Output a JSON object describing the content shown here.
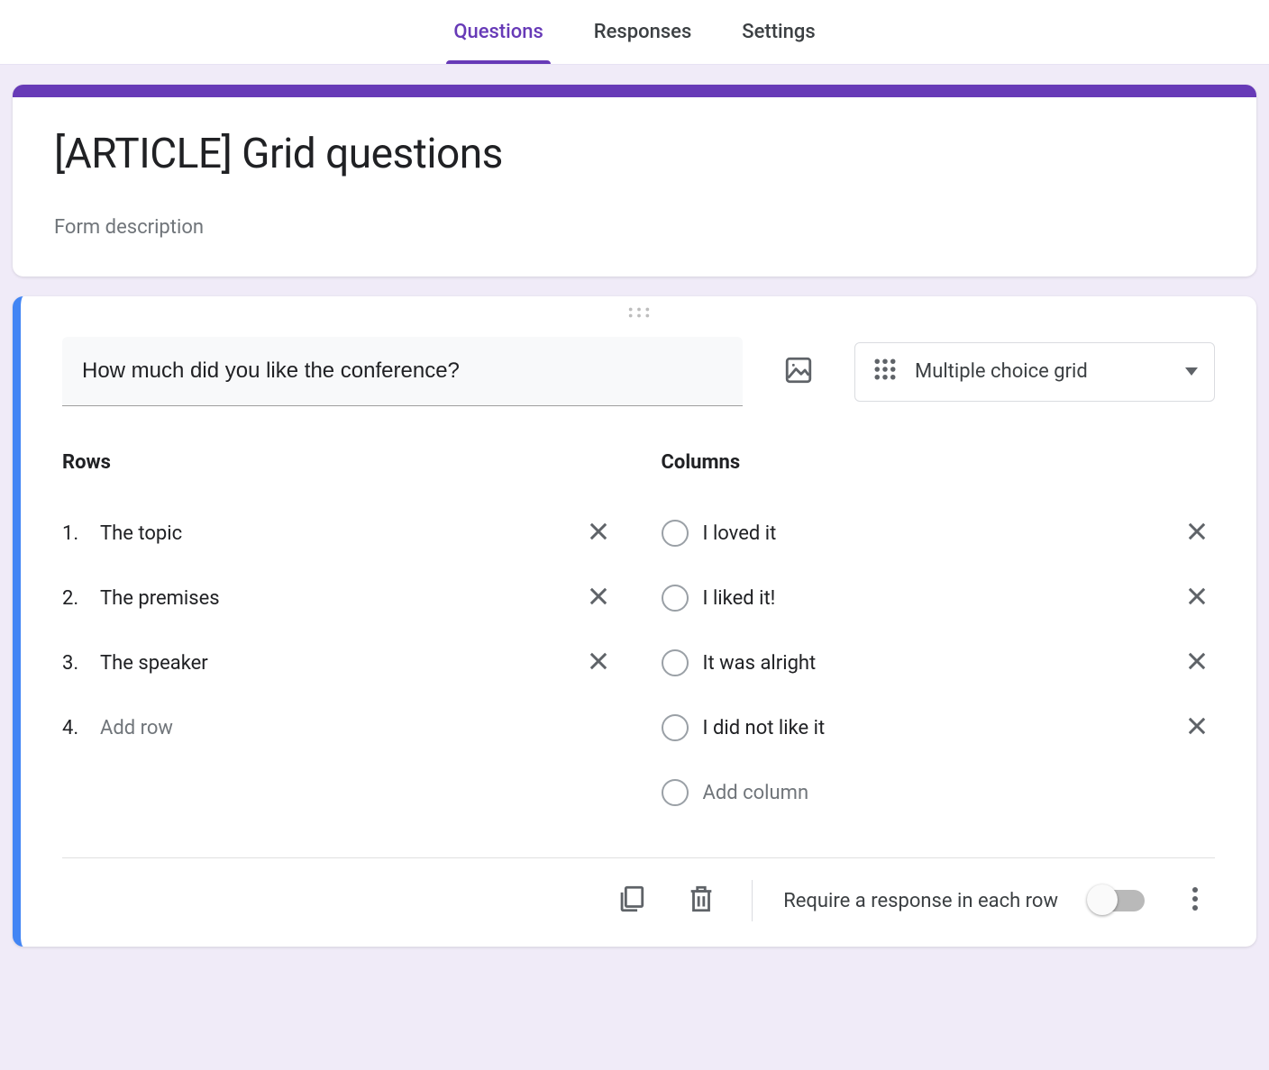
{
  "tabs": {
    "questions": "Questions",
    "responses": "Responses",
    "settings": "Settings"
  },
  "form": {
    "title": "[ARTICLE] Grid questions",
    "description_placeholder": "Form description"
  },
  "question": {
    "title": "How much did you like the conference?",
    "type_label": "Multiple choice grid",
    "rows_heading": "Rows",
    "columns_heading": "Columns",
    "rows": [
      {
        "num": "1.",
        "label": "The topic"
      },
      {
        "num": "2.",
        "label": "The premises"
      },
      {
        "num": "3.",
        "label": "The speaker"
      }
    ],
    "add_row_num": "4.",
    "add_row_placeholder": "Add row",
    "columns": [
      {
        "label": "I loved it"
      },
      {
        "label": "I liked it!"
      },
      {
        "label": "It was alright"
      },
      {
        "label": "I did not like it"
      }
    ],
    "add_column_placeholder": "Add column",
    "require_label": "Require a response in each row",
    "required": false
  }
}
